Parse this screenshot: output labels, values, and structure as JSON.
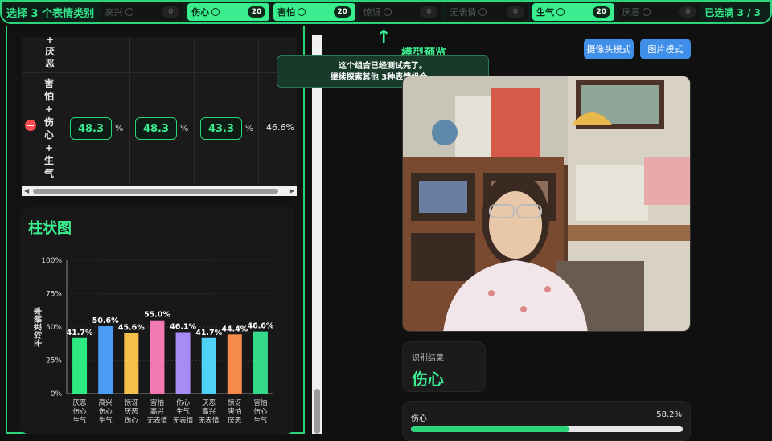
{
  "topbar": {
    "title": "选择 3 个表情类别",
    "emotions": [
      {
        "label": "高兴",
        "count": "0",
        "selected": false
      },
      {
        "label": "伤心",
        "count": "20",
        "selected": true
      },
      {
        "label": "害怕",
        "count": "20",
        "selected": true
      },
      {
        "label": "惊讶",
        "count": "0",
        "selected": false
      },
      {
        "label": "无表情",
        "count": "0",
        "selected": false
      },
      {
        "label": "生气",
        "count": "20",
        "selected": true
      },
      {
        "label": "厌恶",
        "count": "0",
        "selected": false
      }
    ],
    "status": "已选满 3 / 3"
  },
  "table": {
    "top_combo": [
      "+",
      "厌",
      "恶"
    ],
    "row": {
      "combo": [
        "害",
        "怕",
        "+",
        "伤",
        "心",
        "+",
        "生",
        "气"
      ],
      "values": [
        "48.3",
        "48.3",
        "43.3"
      ],
      "pct_sign": "%",
      "average": "46.6%"
    }
  },
  "chart_card": {
    "title": "柱状图"
  },
  "chart_data": {
    "type": "bar",
    "title": "",
    "ylabel": "平均准确率",
    "xlabel": "",
    "ylim": [
      0,
      100
    ],
    "yticks": [
      "0%",
      "25%",
      "50%",
      "75%",
      "100%"
    ],
    "grid": true,
    "categories": [
      [
        "厌恶",
        "伤心",
        "生气"
      ],
      [
        "高兴",
        "伤心",
        "生气"
      ],
      [
        "惊讶",
        "厌恶",
        "伤心"
      ],
      [
        "害怕",
        "高兴",
        "无表情"
      ],
      [
        "伤心",
        "生气",
        "无表情"
      ],
      [
        "厌恶",
        "高兴",
        "无表情"
      ],
      [
        "惊讶",
        "害怕",
        "厌恶"
      ],
      [
        "害怕",
        "伤心",
        "生气"
      ]
    ],
    "values": [
      41.7,
      50.6,
      45.6,
      55.0,
      46.1,
      41.7,
      44.4,
      46.6
    ],
    "labels": [
      "41.7%",
      "50.6%",
      "45.6%",
      "55.0%",
      "46.1%",
      "41.7%",
      "44.4%",
      "46.6%"
    ],
    "colors": [
      "#2ee882",
      "#4a9cf5",
      "#f5c04a",
      "#f279b4",
      "#a88cf5",
      "#4fd3f5",
      "#f58a4a",
      "#34d98a"
    ]
  },
  "preview": {
    "title": "模型预览",
    "camera_button": "摄像头模式",
    "image_button": "图片模式",
    "tooltip_line1": "这个组合已经测试完了。",
    "tooltip_line2": "继续探索其他 3种表情组合。",
    "arrow": "↑"
  },
  "result": {
    "label": "识别结果",
    "value": "伤心"
  },
  "probabilities": [
    {
      "name": "伤心",
      "value": "58.2%",
      "fraction": 0.582
    }
  ],
  "colors": {
    "accent": "#3aee8f",
    "button": "#3f8ee8"
  }
}
